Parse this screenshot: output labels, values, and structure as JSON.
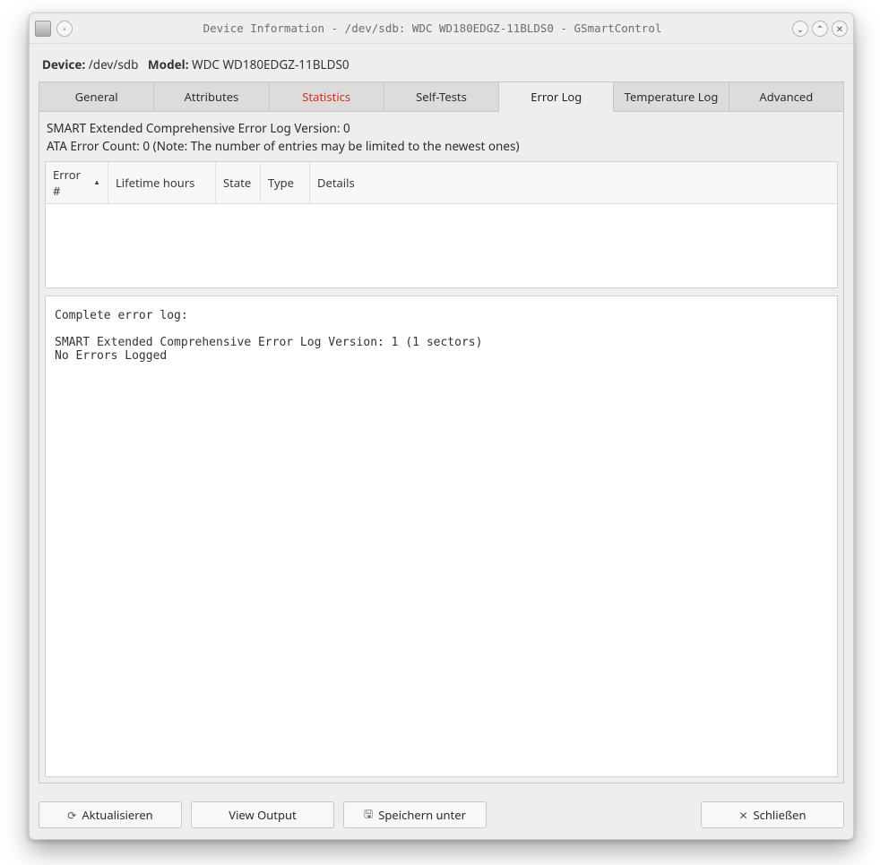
{
  "window": {
    "title": "Device Information - /dev/sdb: WDC WD180EDGZ-11BLDS0 - GSmartControl"
  },
  "header": {
    "device_label": "Device:",
    "device_value": "/dev/sdb",
    "model_label": "Model:",
    "model_value": "WDC WD180EDGZ-11BLDS0"
  },
  "tabs": {
    "general": "General",
    "attributes": "Attributes",
    "statistics": "Statistics",
    "self_tests": "Self-Tests",
    "error_log": "Error Log",
    "temperature_log": "Temperature Log",
    "advanced": "Advanced"
  },
  "errorlog": {
    "line1": "SMART Extended Comprehensive Error Log Version: 0",
    "line2": "ATA Error Count: 0 (Note: The number of entries may be limited to the newest ones)",
    "columns": {
      "error_no": "Error #",
      "lifetime_hours": "Lifetime hours",
      "state": "State",
      "type": "Type",
      "details": "Details"
    },
    "log_text": "Complete error log:\n\nSMART Extended Comprehensive Error Log Version: 1 (1 sectors)\nNo Errors Logged"
  },
  "buttons": {
    "refresh": "Aktualisieren",
    "view_output": "View Output",
    "save_as": "Speichern unter",
    "close": "Schließen"
  }
}
